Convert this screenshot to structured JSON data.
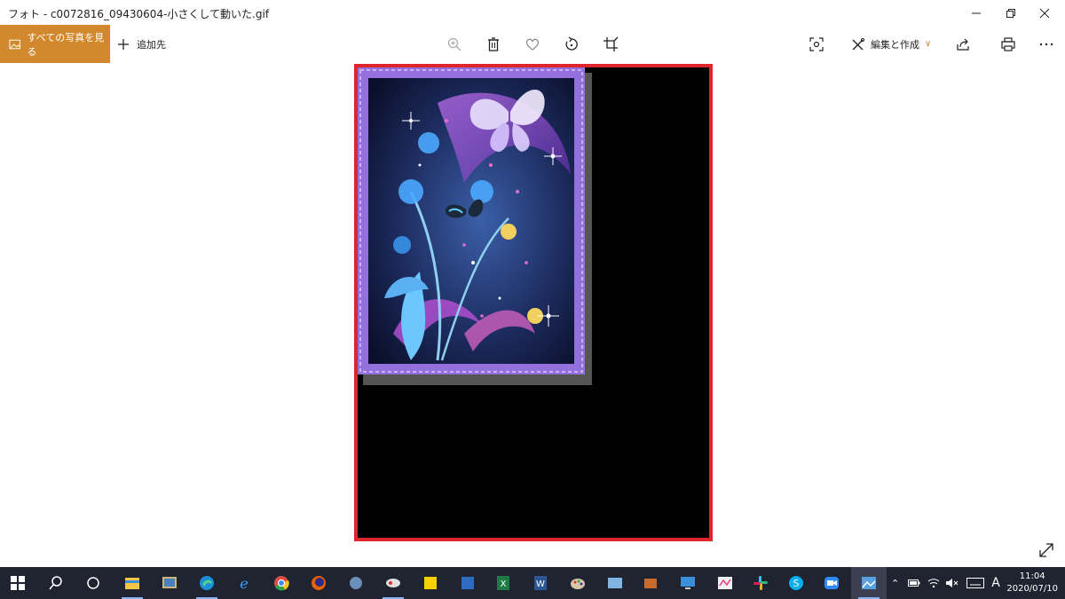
{
  "window": {
    "title": "フォト - c0072816_09430604-小さくして動いた.gif"
  },
  "toolbar": {
    "all_photos_label": "すべての写真を見る",
    "add_to_label": "追加先",
    "edit_create_label": "編集と作成",
    "accent_color": "#d2882c"
  },
  "icons": {
    "zoom": "zoom-in-icon",
    "delete": "trash-icon",
    "favorite": "heart-icon",
    "rotate": "rotate-icon",
    "crop": "crop-icon",
    "enhance": "enhance-icon",
    "edit": "edit-icon",
    "share": "share-icon",
    "print": "print-icon",
    "more": "more-icon"
  },
  "image": {
    "frame_color": "#e0242c",
    "background_color": "#000000"
  },
  "taskbar": {
    "apps": [
      "start",
      "search",
      "task-view",
      "file-explorer",
      "photos-app",
      "edge",
      "internet-explorer",
      "chrome",
      "firefox",
      "app-9",
      "app-10",
      "sticky-notes",
      "app-12",
      "excel",
      "word",
      "paint",
      "app-16",
      "app-17",
      "remote-desktop",
      "app-19",
      "slack",
      "skype",
      "zoom",
      "photos"
    ],
    "ime_label": "A",
    "time": "11:04",
    "date": "2020/07/10"
  }
}
